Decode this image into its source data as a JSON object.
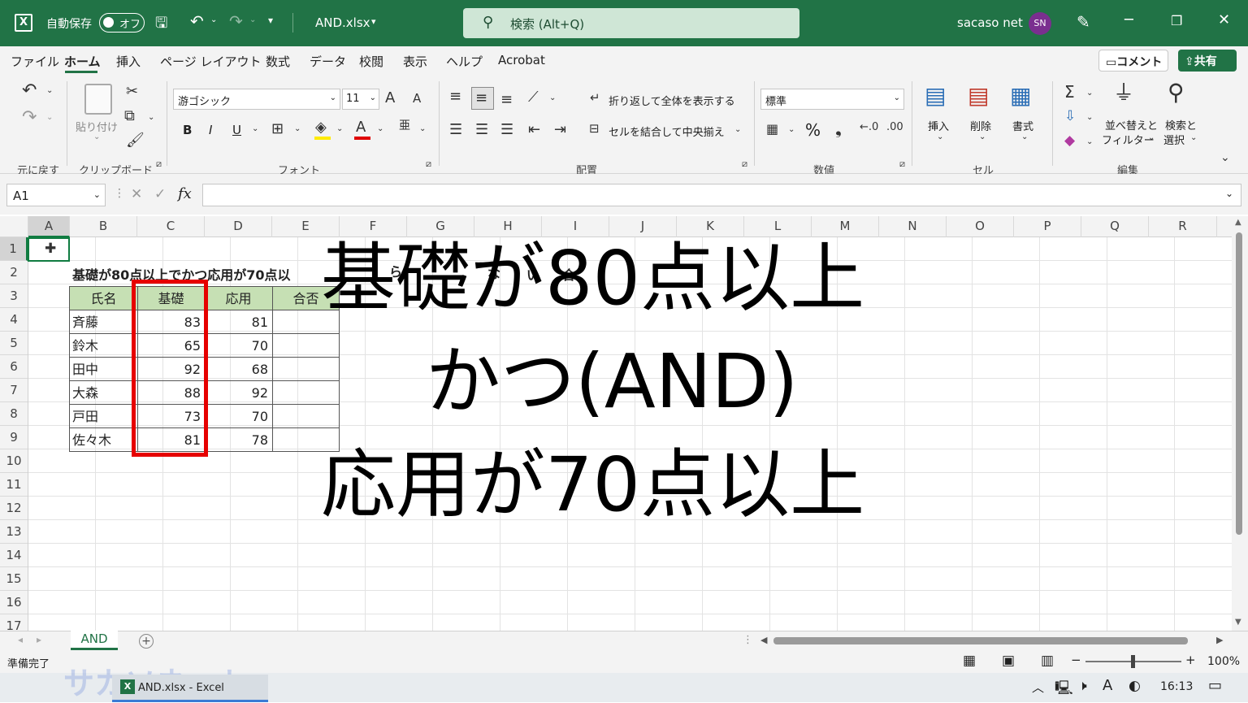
{
  "title_bar": {
    "autosave_label": "自動保存",
    "autosave_state": "オフ",
    "filename": "AND.xlsx",
    "search_placeholder": "検索 (Alt+Q)",
    "user_name": "sacaso net",
    "user_initials": "SN"
  },
  "menu": {
    "items": [
      "ファイル",
      "ホーム",
      "挿入",
      "ページ レイアウト",
      "数式",
      "データ",
      "校閲",
      "表示",
      "ヘルプ",
      "Acrobat"
    ],
    "active": "ホーム",
    "comment_button": "コメント",
    "share_button": "共有"
  },
  "ribbon": {
    "undo_group": "元に戻す",
    "clipboard": {
      "paste": "貼り付け",
      "group": "クリップボード"
    },
    "font": {
      "name": "游ゴシック",
      "size": "11",
      "bold": "B",
      "italic": "I",
      "underline": "U",
      "group": "フォント"
    },
    "alignment": {
      "wrap": "折り返して全体を表示する",
      "merge": "セルを結合して中央揃え",
      "group": "配置"
    },
    "number": {
      "format": "標準",
      "percent": "%",
      "group": "数値"
    },
    "cells": {
      "insert": "挿入",
      "delete": "削除",
      "format": "書式",
      "group": "セル"
    },
    "editing": {
      "sort_filter_1": "並べ替えと",
      "sort_filter_2": "フィルター",
      "find_select_1": "検索と",
      "find_select_2": "選択",
      "group": "編集"
    }
  },
  "formula_bar": {
    "name_box": "A1",
    "fx": "fx"
  },
  "columns": [
    "A",
    "B",
    "C",
    "D",
    "E",
    "F",
    "G",
    "H",
    "I",
    "J",
    "K",
    "L",
    "M",
    "N",
    "O",
    "P",
    "Q",
    "R"
  ],
  "rows": [
    "1",
    "2",
    "3",
    "4",
    "5",
    "6",
    "7",
    "8",
    "9",
    "10",
    "11",
    "12",
    "13",
    "14",
    "15",
    "16",
    "17"
  ],
  "sheet": {
    "heading_visible": "基礎が80点以上でかつ応用が70点以",
    "heading_fragments": [
      "ら",
      "な",
      "い",
      "合"
    ],
    "table_headers": [
      "氏名",
      "基礎",
      "応用",
      "合否"
    ],
    "table_rows": [
      {
        "name": "斉藤",
        "basic": "83",
        "applied": "81"
      },
      {
        "name": "鈴木",
        "basic": "65",
        "applied": "70"
      },
      {
        "name": "田中",
        "basic": "92",
        "applied": "68"
      },
      {
        "name": "大森",
        "basic": "88",
        "applied": "92"
      },
      {
        "name": "戸田",
        "basic": "73",
        "applied": "70"
      },
      {
        "name": "佐々木",
        "basic": "81",
        "applied": "78"
      }
    ],
    "header_fill": "#c6e0b4",
    "highlight_color": "#e60000"
  },
  "overlay": {
    "line1": "基礎が80点以上",
    "line2": "かつ(AND)",
    "line3": "応用が70点以上"
  },
  "sheet_tabs": {
    "active": "AND",
    "add": "+"
  },
  "status": {
    "ready": "準備完了",
    "zoom": "100%"
  },
  "taskbar": {
    "app_item": "AND.xlsx - Excel",
    "time": "16:13",
    "watermark": "サカソネット"
  }
}
